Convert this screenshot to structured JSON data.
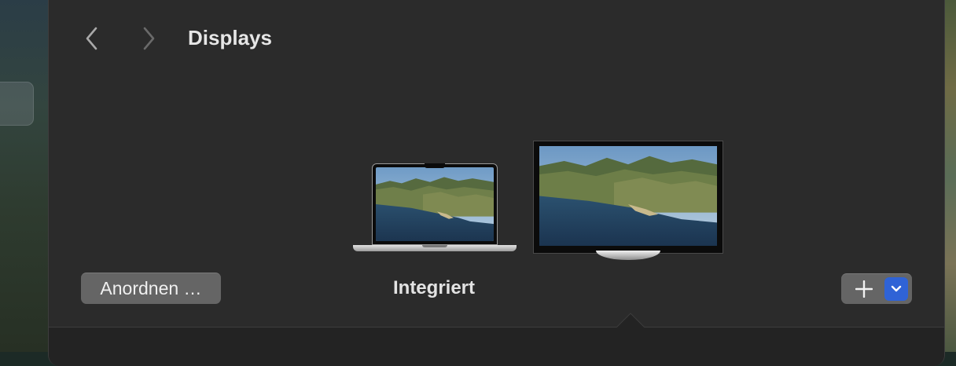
{
  "window": {
    "title": "Displays"
  },
  "navigation": {
    "back_icon": "chevron-left-icon",
    "forward_icon": "chevron-right-icon"
  },
  "arrangement": {
    "displays": [
      {
        "type": "laptop",
        "label": "Integriert",
        "selected": true
      },
      {
        "type": "external-monitor",
        "label": "",
        "selected": false
      }
    ]
  },
  "actions": {
    "arrange_label": "Anordnen …",
    "add_icon": "plus-icon",
    "menu_icon": "chevron-down-icon"
  },
  "colors": {
    "window_bg": "#2b2b2b",
    "button_bg": "#656565",
    "accent": "#2f63d6"
  }
}
